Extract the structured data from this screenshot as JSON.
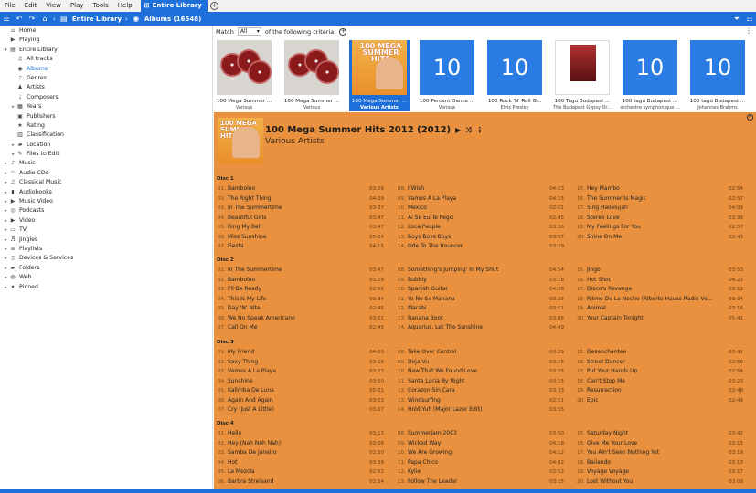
{
  "menu": [
    "File",
    "Edit",
    "View",
    "Play",
    "Tools",
    "Help"
  ],
  "active_tab": "Entire Library",
  "breadcrumbs": [
    "Entire Library",
    "Albums (16548)"
  ],
  "sidebar": [
    {
      "label": "Home",
      "icon": "home-icon",
      "depth": 0,
      "tw": ""
    },
    {
      "label": "Playing",
      "icon": "playing-icon",
      "depth": 0,
      "tw": ""
    },
    {
      "label": "Entire Library",
      "icon": "library-icon",
      "depth": 0,
      "tw": "▾"
    },
    {
      "label": "All tracks",
      "icon": "tracks-icon",
      "depth": 1,
      "tw": ""
    },
    {
      "label": "Albums",
      "icon": "albums-icon",
      "depth": 1,
      "tw": "",
      "selected": true
    },
    {
      "label": "Genres",
      "icon": "genres-icon",
      "depth": 1,
      "tw": ""
    },
    {
      "label": "Artists",
      "icon": "artists-icon",
      "depth": 1,
      "tw": ""
    },
    {
      "label": "Composers",
      "icon": "composers-icon",
      "depth": 1,
      "tw": ""
    },
    {
      "label": "Years",
      "icon": "years-icon",
      "depth": 1,
      "tw": "▸"
    },
    {
      "label": "Publishers",
      "icon": "publishers-icon",
      "depth": 1,
      "tw": ""
    },
    {
      "label": "Rating",
      "icon": "rating-icon",
      "depth": 1,
      "tw": ""
    },
    {
      "label": "Classification",
      "icon": "classification-icon",
      "depth": 1,
      "tw": ""
    },
    {
      "label": "Location",
      "icon": "folder-icon",
      "depth": 1,
      "tw": "▸"
    },
    {
      "label": "Files to Edit",
      "icon": "edit-icon",
      "depth": 1,
      "tw": "▸"
    },
    {
      "label": "Music",
      "icon": "music-icon",
      "depth": 0,
      "tw": "▸"
    },
    {
      "label": "Audio CDs",
      "icon": "headphones-icon",
      "depth": 0,
      "tw": "▸"
    },
    {
      "label": "Classical Music",
      "icon": "classical-icon",
      "depth": 0,
      "tw": "▸"
    },
    {
      "label": "Audiobooks",
      "icon": "audiobook-icon",
      "depth": 0,
      "tw": "▸"
    },
    {
      "label": "Music Video",
      "icon": "music-video-icon",
      "depth": 0,
      "tw": "▸"
    },
    {
      "label": "Podcasts",
      "icon": "podcast-icon",
      "depth": 0,
      "tw": "▸"
    },
    {
      "label": "Video",
      "icon": "video-icon",
      "depth": 0,
      "tw": "▸"
    },
    {
      "label": "TV",
      "icon": "tv-icon",
      "depth": 0,
      "tw": "▸"
    },
    {
      "label": "Jingles",
      "icon": "jingles-icon",
      "depth": 0,
      "tw": "▸"
    },
    {
      "label": "Playlists",
      "icon": "playlist-icon",
      "depth": 0,
      "tw": "▸"
    },
    {
      "label": "Devices & Services",
      "icon": "devices-icon",
      "depth": 0,
      "tw": "▸"
    },
    {
      "label": "Folders",
      "icon": "folder-icon",
      "depth": 0,
      "tw": "▸"
    },
    {
      "label": "Web",
      "icon": "web-icon",
      "depth": 0,
      "tw": "▸"
    },
    {
      "label": "Pinned",
      "icon": "pin-icon",
      "depth": 0,
      "tw": "▸"
    }
  ],
  "criteria": {
    "prefix": "Match",
    "select": "All",
    "suffix": "of the following criteria:"
  },
  "albums": [
    {
      "title": "100 Mega Summer ...",
      "artist": "Various",
      "cover": "disc"
    },
    {
      "title": "100 Mega Summer ...",
      "artist": "Various",
      "cover": "disc"
    },
    {
      "title": "100 Mega Summer ...",
      "artist": "Various Artists",
      "cover": "mega",
      "selected": true
    },
    {
      "title": "100 Percent Dance ...",
      "artist": "Various",
      "cover": "num",
      "num": "10"
    },
    {
      "title": "100 Rock 'N' Roll G...",
      "artist": "Elvis Presley",
      "cover": "num",
      "num": "10"
    },
    {
      "title": "100 Tagú Budapest ...",
      "artist": "The Budapest Gypsy Or...",
      "cover": "budapest"
    },
    {
      "title": "100 tagú Budapest ...",
      "artist": "orchestre symphonique ...",
      "cover": "num",
      "num": "10"
    },
    {
      "title": "100 tagú Budapest ...",
      "artist": "Johannes Brahms",
      "cover": "num",
      "num": "10"
    }
  ],
  "detail": {
    "cover_text": "100 MEGA SUMMER HITS",
    "title": "100 Mega Summer Hits 2012  (2012)",
    "artist": "Various Artists",
    "discs": [
      {
        "label": "Disc 1",
        "columns": [
          [
            [
              "01.",
              "Bamboleo",
              "03:26"
            ],
            [
              "02.",
              "The Right Thing",
              "04:29"
            ],
            [
              "03.",
              "In The Summertime",
              "03:37"
            ],
            [
              "04.",
              "Beautiful Girls",
              "03:47"
            ],
            [
              "05.",
              "Ring My Bell",
              "03:47"
            ],
            [
              "06.",
              "Miss Sunshine",
              "05:24"
            ],
            [
              "07.",
              "Fiesta",
              "04:15"
            ]
          ],
          [
            [
              "08.",
              "I Wish",
              "04:13"
            ],
            [
              "09.",
              "Vamos A La Playa",
              "04:15"
            ],
            [
              "10.",
              "Mexico",
              "02:01"
            ],
            [
              "11.",
              "Ai Se Eu Te Pego",
              "02:45"
            ],
            [
              "12.",
              "Loca People",
              "03:36"
            ],
            [
              "13.",
              "Boys Boys Boys",
              "03:57"
            ],
            [
              "14.",
              "Ode To The Bouncer",
              "03:29"
            ]
          ],
          [
            [
              "15.",
              "Hey Mambo",
              "02:54"
            ],
            [
              "16.",
              "The Summer Is Magic",
              "02:57"
            ],
            [
              "17.",
              "Sing Hallelujah",
              "04:03"
            ],
            [
              "18.",
              "Stereo Love",
              "03:39"
            ],
            [
              "19.",
              "My Feelings For You",
              "02:57"
            ],
            [
              "20.",
              "Shine On Me",
              "03:43"
            ]
          ]
        ]
      },
      {
        "label": "Disc 2",
        "columns": [
          [
            [
              "01.",
              "In The Summertime",
              "03:47"
            ],
            [
              "02.",
              "Bamboleo",
              "03:29"
            ],
            [
              "03.",
              "I'll Be Ready",
              "02:56"
            ],
            [
              "04.",
              "This Is My Life",
              "03:34"
            ],
            [
              "05.",
              "Day 'N' Nite",
              "02:45"
            ],
            [
              "06.",
              "We No Speak Americano",
              "03:01"
            ],
            [
              "07.",
              "Call On Me",
              "02:45"
            ]
          ],
          [
            [
              "08.",
              "Something's Jumping' In My Shirt",
              "04:54"
            ],
            [
              "09.",
              "Bubbly",
              "03:18"
            ],
            [
              "10.",
              "Spanish Guitar",
              "04:28"
            ],
            [
              "11.",
              "Yo No Se Manana",
              "03:23"
            ],
            [
              "12.",
              "Marabi",
              "03:51"
            ],
            [
              "13.",
              "Banana Boot",
              "03:06"
            ],
            [
              "14.",
              "Aquarius, Let The Sunshine",
              "04:49"
            ]
          ],
          [
            [
              "15.",
              "Jingo",
              "03:53"
            ],
            [
              "16.",
              "Hot Shot",
              "04:23"
            ],
            [
              "17.",
              "Disco's Revenge",
              "03:12"
            ],
            [
              "18.",
              "Ritmo De La Noche (Alberto Hauss Radio Ve...",
              "03:34"
            ],
            [
              "19.",
              "Animal",
              "03:16"
            ],
            [
              "20.",
              "Your Captain Tonight",
              "05:41"
            ]
          ]
        ]
      },
      {
        "label": "Disc 3",
        "columns": [
          [
            [
              "01.",
              "My Friend",
              "04:03"
            ],
            [
              "02.",
              "Sexy Thing",
              "03:18"
            ],
            [
              "03.",
              "Vamos A La Playa",
              "03:23"
            ],
            [
              "04.",
              "Sunshine",
              "03:50"
            ],
            [
              "05.",
              "Kalimba De Luna",
              "05:01"
            ],
            [
              "06.",
              "Again And Again",
              "03:03"
            ],
            [
              "07.",
              "Cry (Just A Little)",
              "03:07"
            ]
          ],
          [
            [
              "08.",
              "Take Over Control",
              "03:29"
            ],
            [
              "09.",
              "Deja Vu",
              "03:15"
            ],
            [
              "10.",
              "Now That We Found Love",
              "03:55"
            ],
            [
              "11.",
              "Santa Lucia By Night",
              "03:15"
            ],
            [
              "12.",
              "Corazon Sin Cara",
              "03:33"
            ],
            [
              "13.",
              "Windsurfing",
              "02:51"
            ],
            [
              "14.",
              "Hold Yuh (Major Lazer Edit)",
              "03:55"
            ]
          ],
          [
            [
              "15.",
              "Desenchantee",
              "03:41"
            ],
            [
              "16.",
              "Street Dancer",
              "02:56"
            ],
            [
              "17.",
              "Put Your Hands Up",
              "02:54"
            ],
            [
              "18.",
              "Can't Stop Me",
              "03:23"
            ],
            [
              "19.",
              "Resurrection",
              "02:48"
            ],
            [
              "20.",
              "Epic",
              "02:49"
            ]
          ]
        ]
      },
      {
        "label": "Disc 4",
        "columns": [
          [
            [
              "01.",
              "Hello",
              "03:13"
            ],
            [
              "02.",
              "Hey (Nah Neh Nah)",
              "03:06"
            ],
            [
              "03.",
              "Samba De Janeiro",
              "02:50"
            ],
            [
              "04.",
              "Hot",
              "03:39"
            ],
            [
              "05.",
              "La Mezcla",
              "02:52"
            ],
            [
              "06.",
              "Barbra Streisand",
              "02:54"
            ]
          ],
          [
            [
              "08.",
              "Summerjam 2003",
              "03:50"
            ],
            [
              "09.",
              "Wicked Way",
              "04:18"
            ],
            [
              "10.",
              "We Are Growing",
              "04:12"
            ],
            [
              "11.",
              "Papa Chico",
              "04:02"
            ],
            [
              "12.",
              "Kylie",
              "02:52"
            ],
            [
              "13.",
              "Follow The Leader",
              "03:15"
            ]
          ],
          [
            [
              "15.",
              "Saturday Night",
              "03:42"
            ],
            [
              "16.",
              "Give Me Your Love",
              "03:15"
            ],
            [
              "17.",
              "You Ain't Seen Nothing Yet",
              "03:19"
            ],
            [
              "18.",
              "Bailando",
              "03:13"
            ],
            [
              "19.",
              "Voyage Voyage",
              "03:17"
            ],
            [
              "20.",
              "Lost Without You",
              "03:08"
            ]
          ]
        ]
      }
    ]
  },
  "colors": {
    "accent": "#1e6fd9",
    "panel": "#e9913e"
  }
}
